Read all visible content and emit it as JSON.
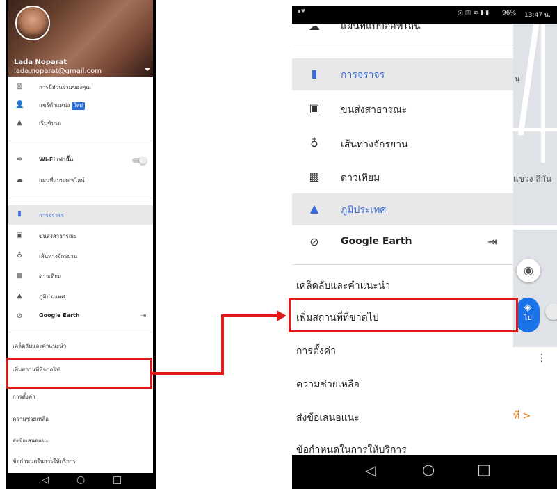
{
  "left": {
    "account": {
      "name": "Lada Noparat",
      "email": "lada.noparat@gmail.com"
    },
    "menu_top": [
      {
        "icon": "contributions-icon",
        "glyph": "▨",
        "label": "การมีส่วนร่วมของคุณ"
      },
      {
        "icon": "share-location-icon",
        "glyph": "👤",
        "label": "แชร์ตำแหน่ง",
        "badge": "ใหม่"
      },
      {
        "icon": "navigation-icon",
        "glyph": "▲",
        "label": "เริ่มขับรถ"
      }
    ],
    "menu_settings": [
      {
        "icon": "wifi-icon",
        "glyph": "≋",
        "label": "Wi-Fi เท่านั้น",
        "toggle": true
      },
      {
        "icon": "offline-maps-icon",
        "glyph": "☁",
        "label": "แผนที่แบบออฟไลน์"
      }
    ],
    "menu_layers": [
      {
        "icon": "traffic-icon",
        "glyph": "▮",
        "label": "การจราจร",
        "active": true
      },
      {
        "icon": "transit-icon",
        "glyph": "▣",
        "label": "ขนส่งสาธารณะ"
      },
      {
        "icon": "bicycle-icon",
        "glyph": "♁",
        "label": "เส้นทางจักรยาน"
      },
      {
        "icon": "satellite-icon",
        "glyph": "▩",
        "label": "ดาวเทียม"
      },
      {
        "icon": "terrain-icon",
        "glyph": "▲",
        "label": "ภูมิประเทศ"
      },
      {
        "icon": "google-earth-icon",
        "glyph": "⊘",
        "label": "Google Earth",
        "bold": true
      }
    ],
    "menu_bottom": [
      "เคล็ดลับและคำแนะนำ",
      "เพิ่มสถานที่ที่ขาดไป",
      "การตั้งค่า",
      "ความช่วยเหลือ",
      "ส่งข้อเสนอแนะ",
      "ข้อกำหนดในการให้บริการ"
    ],
    "navbar": {
      "back": "◁",
      "home": "○",
      "recents": "□"
    }
  },
  "right": {
    "status": {
      "battery": "96%",
      "time": "13:47 น."
    },
    "menu_top_partial": {
      "icon": "offline-maps-icon",
      "glyph": "☁",
      "label": "แผนที่แบบออฟไลน์"
    },
    "menu_layers": [
      {
        "icon": "traffic-icon",
        "glyph": "▮",
        "label": "การจราจร",
        "highlight": true,
        "blue": true
      },
      {
        "icon": "transit-icon",
        "glyph": "▣",
        "label": "ขนส่งสาธารณะ"
      },
      {
        "icon": "bicycle-icon",
        "glyph": "♁",
        "label": "เส้นทางจักรยาน"
      },
      {
        "icon": "satellite-icon",
        "glyph": "▩",
        "label": "ดาวเทียม"
      },
      {
        "icon": "terrain-icon",
        "glyph": "▲",
        "label": "ภูมิประเทศ",
        "highlight": true,
        "blue": true
      },
      {
        "icon": "google-earth-icon",
        "glyph": "⊘",
        "label": "Google Earth",
        "bold": true
      }
    ],
    "menu_bottom": [
      "เคล็ดลับและคำแนะนำ",
      "เพิ่มสถานที่ที่ขาดไป",
      "การตั้งค่า",
      "ความช่วยเหลือ",
      "ส่งข้อเสนอแนะ",
      "ข้อกำหนดในการให้บริการ"
    ],
    "map_labels": {
      "district": "แขวง สีกัน",
      "go": "ไป",
      "more": "ที >",
      "nu": "นุ"
    },
    "navbar": {
      "back": "◁",
      "home": "○",
      "recents": "□"
    }
  },
  "colors": {
    "accent": "#3b6bd6",
    "annotation": "#e01818",
    "highlight": "#e8e8e8"
  }
}
